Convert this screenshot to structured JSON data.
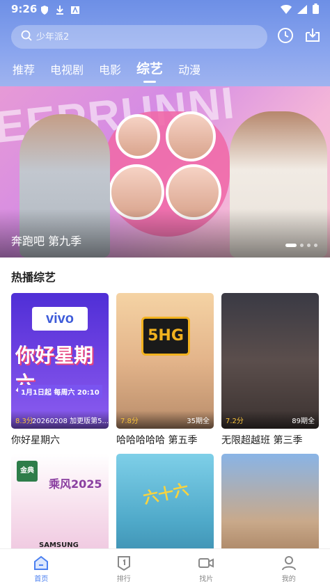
{
  "status_bar": {
    "time": "9:26",
    "icons": [
      "shield-icon",
      "download-icon",
      "a-icon",
      "wifi-icon",
      "signal-icon",
      "battery-icon"
    ]
  },
  "header": {
    "search_placeholder": "少年派2",
    "icons": [
      "history-icon",
      "download-icon"
    ],
    "tabs": [
      {
        "label": "推荐",
        "active": false
      },
      {
        "label": "电视剧",
        "active": false
      },
      {
        "label": "电影",
        "active": false
      },
      {
        "label": "综艺",
        "active": true
      },
      {
        "label": "动漫",
        "active": false
      }
    ]
  },
  "banner": {
    "title": "奔跑吧 第九季",
    "watermark_text": "EEPRUNNI",
    "page_count": 4,
    "active_index": 0
  },
  "section": {
    "title": "热播综艺"
  },
  "cards": [
    {
      "title": "你好星期六",
      "score": "8.3分",
      "episode": "20260208 加更版第5...",
      "poster_text": "vivo",
      "poster_sub": "你好星期六",
      "poster_date": "1月1日起 每周六 20:10"
    },
    {
      "title": "哈哈哈哈哈 第五季",
      "score": "7.8分",
      "episode": "35期全",
      "poster_text": "5HG"
    },
    {
      "title": "无限超越班 第三季",
      "score": "7.2分",
      "episode": "89期全"
    },
    {
      "title": "",
      "score": "",
      "episode": "",
      "poster_text": "乘风2025",
      "poster_brand": "金典",
      "poster_sponsor": "SAMSUNG"
    },
    {
      "title": "",
      "score": "",
      "episode": "",
      "poster_text": "六十六"
    },
    {
      "title": "",
      "score": "",
      "episode": ""
    }
  ],
  "bottom_nav": [
    {
      "label": "首页",
      "icon": "home-icon",
      "active": true
    },
    {
      "label": "排行",
      "icon": "ranking-icon",
      "active": false
    },
    {
      "label": "找片",
      "icon": "video-camera-icon",
      "active": false
    },
    {
      "label": "我的",
      "icon": "user-icon",
      "active": false
    }
  ],
  "colors": {
    "header_gradient_top": "#6d8fe6",
    "accent": "#4a7ff0",
    "score": "#f6c23a"
  }
}
